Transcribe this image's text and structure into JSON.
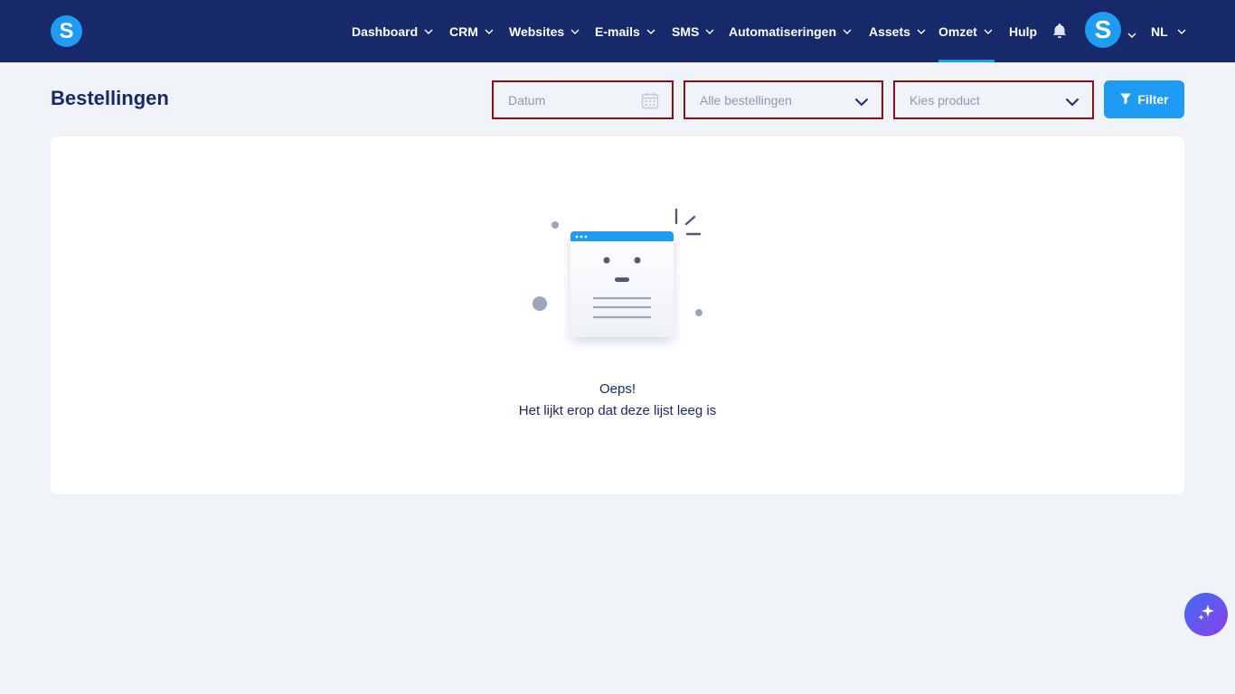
{
  "nav": {
    "items": [
      {
        "label": "Dashboard",
        "has_menu": true
      },
      {
        "label": "CRM",
        "has_menu": true
      },
      {
        "label": "Websites",
        "has_menu": true
      },
      {
        "label": "E-mails",
        "has_menu": true
      },
      {
        "label": "SMS",
        "has_menu": true
      },
      {
        "label": "Automatiseringen",
        "has_menu": true
      },
      {
        "label": "Assets",
        "has_menu": true
      },
      {
        "label": "Omzet",
        "has_menu": true,
        "active": true
      },
      {
        "label": "Hulp",
        "has_menu": false
      }
    ],
    "logo_letter": "S",
    "avatar_letter": "S",
    "language": "NL",
    "notification_icon": "bell-icon"
  },
  "page": {
    "title": "Bestellingen"
  },
  "filters": {
    "date_placeholder": "Datum",
    "orders_select": "Alle bestellingen",
    "product_select": "Kies product",
    "filter_button": "Filter"
  },
  "empty_state": {
    "title": "Oeps!",
    "message": "Het lijkt erop dat deze lijst leeg is"
  },
  "colors": {
    "nav_bg": "#17296b",
    "accent": "#1e9bf2",
    "page_bg": "#f0f3f8",
    "field_border": "#8b0f14"
  }
}
